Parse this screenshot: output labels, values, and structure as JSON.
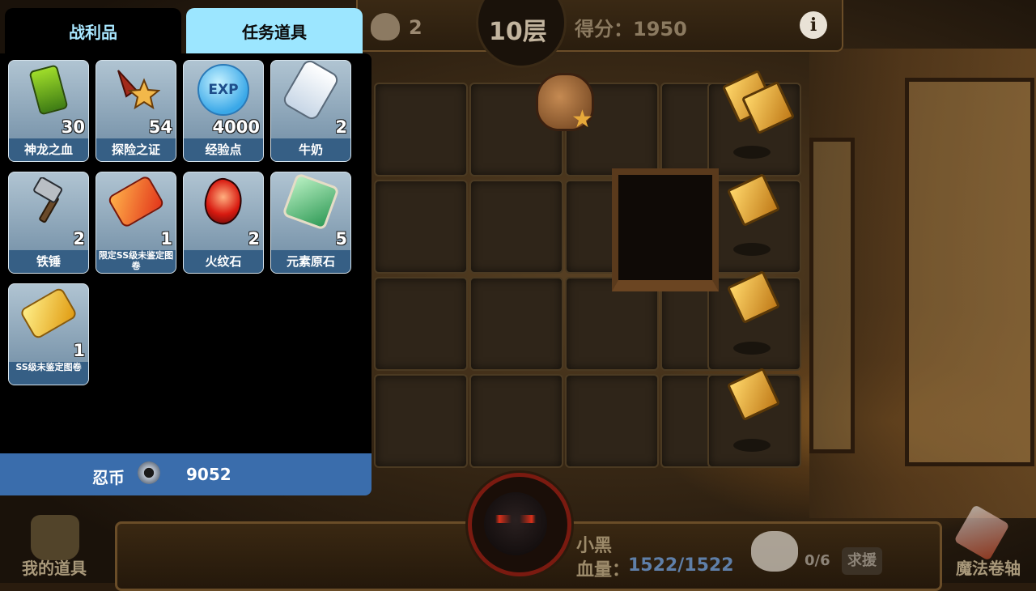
{
  "tabs": {
    "loot": "战利品",
    "quest_items": "任务道具",
    "active": "loot"
  },
  "top_bar": {
    "rice_count": "2",
    "floor": "10层",
    "score": "得分：1950",
    "info_icon": "info-icon"
  },
  "inventory": {
    "items": [
      {
        "name": "神龙之血",
        "count": "30",
        "icon": "dragon-blood-icon"
      },
      {
        "name": "探险之证",
        "count": "54",
        "icon": "medal-icon"
      },
      {
        "name": "经验点",
        "count": "4000",
        "icon": "exp-orb-icon",
        "badge": "EXP"
      },
      {
        "name": "牛奶",
        "count": "2",
        "icon": "milk-bottle-icon"
      },
      {
        "name": "铁锤",
        "count": "2",
        "icon": "hammer-icon"
      },
      {
        "name": "限定SS级未鉴定图卷",
        "count": "1",
        "icon": "red-scroll-icon"
      },
      {
        "name": "火纹石",
        "count": "2",
        "icon": "fire-stone-icon"
      },
      {
        "name": "元素原石",
        "count": "5",
        "icon": "element-ore-icon"
      },
      {
        "name": "SS级未鉴定图卷",
        "count": "1",
        "icon": "gold-scroll-icon"
      }
    ],
    "currency_label": "忍币",
    "currency_value": "9052",
    "currency_icon": "ninja-coin-icon"
  },
  "bottom_bar": {
    "my_items": "我的道具",
    "hero_name": "小黑",
    "hp_label": "血量：",
    "hp_value": "1522/1522",
    "helper_count": "0/6",
    "help_button": "求援",
    "magic_scroll": "魔法卷轴"
  },
  "colors": {
    "tab_active_text": "#a9e7ff",
    "tab_inactive_bg": "#9ce6ff",
    "card_label_band": "#365f85",
    "coin_bar": "#3a6dac",
    "hp_value": "#5f7fa8"
  }
}
